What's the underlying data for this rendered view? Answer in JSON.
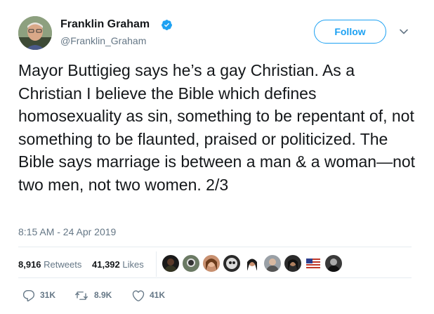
{
  "author": {
    "name": "Franklin Graham",
    "handle": "@Franklin_Graham"
  },
  "follow_label": "Follow",
  "tweet_text": "Mayor Buttigieg says he’s a gay Christian. As a Christian I believe the Bible which defines homosexuality as sin, something to be repentant of, not something to be flaunted, praised or politicized. The Bible says marriage is between a man & a woman—not two men, not two women. 2/3",
  "timestamp": "8:15 AM - 24 Apr 2019",
  "stats": {
    "retweets_count": "8,916",
    "retweets_label": "Retweets",
    "likes_count": "41,392",
    "likes_label": "Likes"
  },
  "actions": {
    "replies": "31K",
    "retweets": "8.9K",
    "likes": "41K"
  },
  "colors": {
    "accent": "#1da1f2",
    "text": "#14171a",
    "muted": "#657786",
    "divider": "#e6ecf0"
  },
  "icons": [
    "verified-badge-icon",
    "chevron-down-icon",
    "reply-icon",
    "retweet-icon",
    "like-icon"
  ]
}
